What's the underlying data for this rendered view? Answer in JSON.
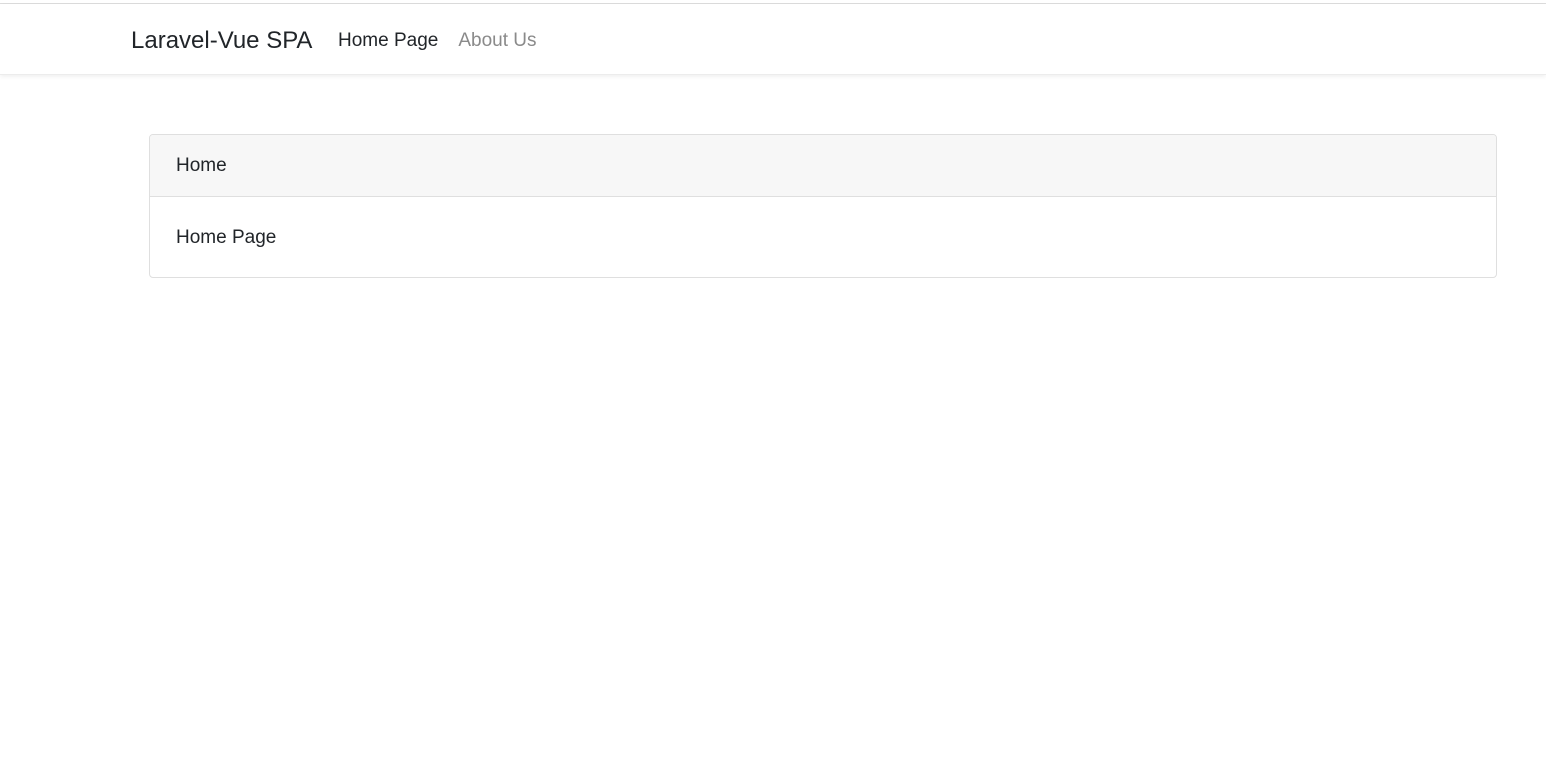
{
  "navbar": {
    "brand": "Laravel-Vue SPA",
    "links": [
      {
        "label": "Home Page",
        "active": true
      },
      {
        "label": "About Us",
        "active": false
      }
    ]
  },
  "card": {
    "header": "Home",
    "body": "Home Page"
  },
  "colors": {
    "text": "#212529",
    "muted_link": "#8a8a8a",
    "card_header_bg": "#f7f7f7",
    "border": "#dfdfdf"
  }
}
